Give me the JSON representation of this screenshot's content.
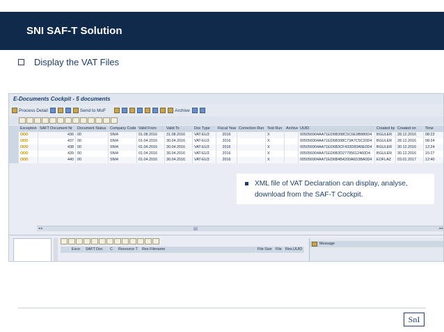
{
  "slide": {
    "title": "SNI SAF-T Solution",
    "bullet": "Display the VAT Files",
    "callout_text": "XML file of VAT Declaration can display, analyse, download from the SAF-T Cockpit.",
    "logo_text": "SnI"
  },
  "sap": {
    "window_title": "E-Documents Cockpit  - 5 documents",
    "toolbar": {
      "process_detail": "Process Detail",
      "send_to_mof": "Send to MoF",
      "archive": "Archive"
    },
    "grid": {
      "columns": [
        "Exception",
        "SAFT Document Nr",
        "Document Status",
        "Company Code",
        "Valid From",
        "Valid To",
        "Doc Type",
        "Fiscal Year",
        "Correction Run",
        "Test Run",
        "Archive",
        "UUID",
        "Created by",
        "Created on",
        "Time"
      ],
      "rows": [
        {
          "exception": "OOO",
          "saft_nr": "436",
          "status": "00",
          "company": "SNI4",
          "valid_from": "01.08.2016",
          "valid_to": "31.08.2016",
          "doc_type": "VAT-EU3",
          "fiscal_year": "2016",
          "correction": "",
          "test_run": "X",
          "archive": "",
          "uuid": "005056904AA71ED6B398C5C6E9B880D4",
          "created_by": "BGULER",
          "created_on": "28.12.2016",
          "time": "08:23"
        },
        {
          "exception": "OOO",
          "saft_nr": "437",
          "status": "00",
          "company": "SNI4",
          "valid_from": "01.04.2016",
          "valid_to": "30.04.2016",
          "doc_type": "VAT-EU3",
          "fiscal_year": "2016",
          "correction": "",
          "test_run": "X",
          "archive": "",
          "uuid": "005056904AA71ED6B398C73A7C5C20D4",
          "created_by": "BGULER",
          "created_on": "28.12.2016",
          "time": "08:24"
        },
        {
          "exception": "OOO",
          "saft_nr": "438",
          "status": "00",
          "company": "SNI4",
          "valid_from": "01.04.2016",
          "valid_to": "30.04.2016",
          "doc_type": "VAT-EU3",
          "fiscal_year": "2016",
          "correction": "",
          "test_run": "X",
          "archive": "",
          "uuid": "005056904AA71ED6B3CF433D83A5E0D4",
          "created_by": "BGULER",
          "created_on": "30.12.2016",
          "time": "12:24"
        },
        {
          "exception": "OOO",
          "saft_nr": "439",
          "status": "00",
          "company": "SNI4",
          "valid_from": "01.04.2016",
          "valid_to": "30.04.2016",
          "doc_type": "VAT-EU3",
          "fiscal_year": "2016",
          "correction": "",
          "test_run": "X",
          "archive": "",
          "uuid": "005056904AA71ED6B3D27795612460D4",
          "created_by": "BGULER",
          "created_on": "30.12.2016",
          "time": "15:27"
        },
        {
          "exception": "OOO",
          "saft_nr": "440",
          "status": "00",
          "company": "SNI4",
          "valid_from": "01.04.2016",
          "valid_to": "30.04.2016",
          "doc_type": "VAT-EU3",
          "fiscal_year": "2016",
          "correction": "",
          "test_run": "X",
          "archive": "",
          "uuid": "005056904AA71ED6B4B4200A6D3BA0D4",
          "created_by": "EOFLAZ",
          "created_on": "03.01.2017",
          "time": "12:40"
        }
      ]
    },
    "bottom_grid": {
      "columns": [
        "Exce",
        "SAFT Doc",
        "C",
        "Resource T",
        "Res Filename",
        "File Size",
        "File",
        "Res.UUID"
      ]
    },
    "message_pane": {
      "header": "Message"
    }
  },
  "colors": {
    "header_bg": "#0f2a4a",
    "accent_text": "#1f3f6a",
    "sap_bg": "#e9edf3"
  }
}
